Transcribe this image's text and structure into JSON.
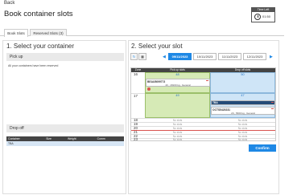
{
  "header": {
    "back_label": "Back",
    "title": "Book container slots",
    "timer_label": "Time Left",
    "timer_value": "01:50"
  },
  "tabs": [
    {
      "label": "Book Slots",
      "active": true
    },
    {
      "label": "Reserved Slots (3)",
      "active": false
    }
  ],
  "left": {
    "section_title": "1. Select your container",
    "pickup_title": "Pick up",
    "pickup_message": "All your containers have been reserved",
    "dropoff_title": "Drop off",
    "columns": [
      "Container",
      "Size",
      "Weight",
      "Comm"
    ],
    "rows": [
      [
        "TBA",
        "",
        "",
        ""
      ]
    ]
  },
  "right": {
    "section_title": "2. Select your slot",
    "dates": [
      "09/11/2023",
      "10/11/2023",
      "11/11/2023",
      "12/11/2023"
    ],
    "active_date_index": 0,
    "grid_headers": {
      "zone": "Zone",
      "pickup": "Pick up slots",
      "dropoff": "Drop off slots"
    },
    "hours": [
      "16",
      "17",
      "18",
      "19",
      "20",
      "21",
      "22",
      "23"
    ],
    "counts": {
      "h16_pickup": "48",
      "h16_dropoff": "50",
      "h17_pickup": "49",
      "h17_dropoff": "47"
    },
    "bookings": [
      {
        "name": "BEAU5699773",
        "detail": "40 , 18100 kg , General"
      },
      {
        "name": "TBA",
        "detail": ""
      },
      {
        "name": "OCTS5420231",
        "detail": "20 , 5600 kg , General"
      }
    ],
    "no_slots_label": "No slots"
  },
  "confirm_label": "Confirm",
  "colors": {
    "accent": "#1e88e5",
    "pickup_zone": "#d6eab6",
    "dropoff_zone": "#cfe5f7",
    "grid_header": "#444444",
    "remove": "#d9534f"
  },
  "icons": {
    "refresh": "refresh-icon",
    "calendar": "calendar-icon",
    "prev": "chevron-left-icon",
    "next": "chevron-right-icon",
    "timer": "clock-icon"
  }
}
